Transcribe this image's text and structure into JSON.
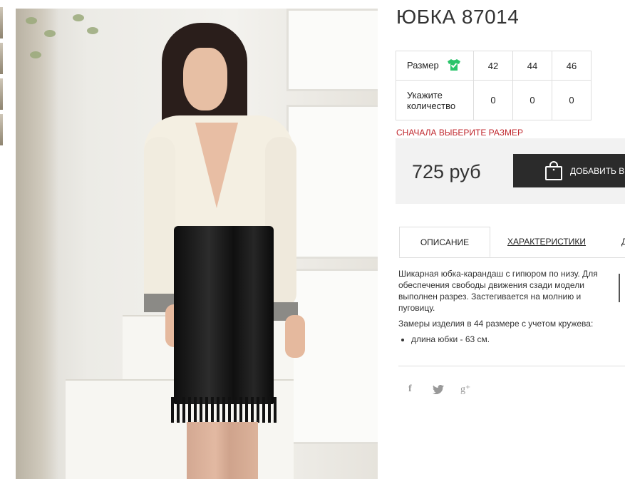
{
  "product": {
    "title": "ЮБКА 87014",
    "size_table": {
      "size_label": "Размер",
      "sizes": [
        "42",
        "44",
        "46"
      ],
      "quantity_label": "Укажите количество",
      "quantities": [
        "0",
        "0",
        "0"
      ]
    },
    "warning": "СНАЧАЛА ВЫБЕРИТЕ РАЗМЕР",
    "price": "725 руб",
    "add_to_cart_label": "ДОБАВИТЬ В"
  },
  "tabs": [
    {
      "label": "ОПИСАНИЕ",
      "active": true
    },
    {
      "label": "ХАРАКТЕРИСТИКИ",
      "active": false
    },
    {
      "label": "Д",
      "active": false
    }
  ],
  "description": {
    "paragraph1": "Шикарная юбка-карандаш с гипюром по низу. Для обеспечения свободы движения сзади модели выполнен разрез. Застегивается на молнию и пуговицу.",
    "paragraph2": "Замеры изделия в 44 размере с учетом кружева:",
    "bullets": [
      "длина юбки - 63 см."
    ]
  },
  "social": [
    {
      "icon": "facebook-icon",
      "glyph": "f"
    },
    {
      "icon": "twitter-icon",
      "glyph": "🐦"
    },
    {
      "icon": "google-plus-icon",
      "glyph": "g⁺"
    }
  ],
  "colors": {
    "warning": "#c0272d",
    "button": "#2b2b2b",
    "size_icon": "#2bc46a"
  }
}
